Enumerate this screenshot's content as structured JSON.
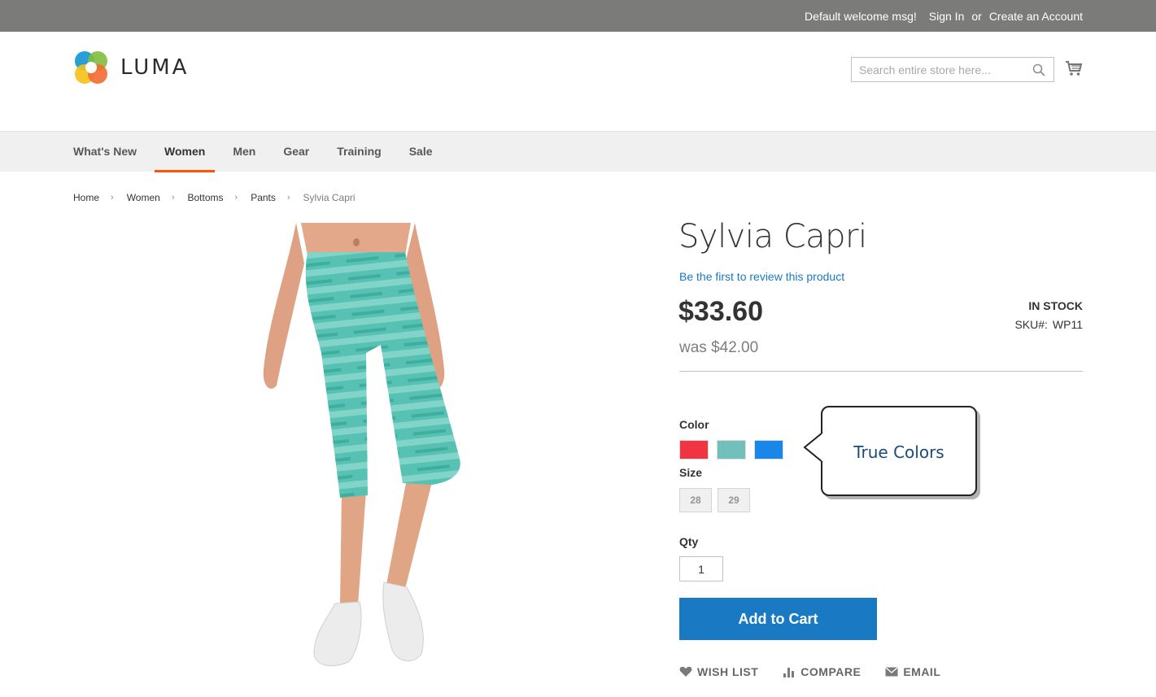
{
  "header": {
    "welcome": "Default welcome msg!",
    "sign_in": "Sign In",
    "or": "or",
    "create_account": "Create an Account",
    "logo_text": "LUMA",
    "search_placeholder": "Search entire store here..."
  },
  "nav": {
    "items": [
      {
        "label": "What's New"
      },
      {
        "label": "Women",
        "active": true
      },
      {
        "label": "Men"
      },
      {
        "label": "Gear"
      },
      {
        "label": "Training"
      },
      {
        "label": "Sale"
      }
    ]
  },
  "breadcrumb": [
    "Home",
    "Women",
    "Bottoms",
    "Pants",
    "Sylvia Capri"
  ],
  "product": {
    "name": "Sylvia Capri",
    "review_link": "Be the first to review this product",
    "price": "$33.60",
    "old_price": "was $42.00",
    "stock": "In stock",
    "sku_label": "SKU#:",
    "sku": "WP11",
    "color_label": "Color",
    "colors": [
      "#ef3542",
      "#72bfbc",
      "#1a87e8"
    ],
    "size_label": "Size",
    "sizes": [
      "28",
      "29"
    ],
    "qty_label": "Qty",
    "qty": "1",
    "add_to_cart": "Add to Cart",
    "actions": [
      "Wish List",
      "Compare",
      "Email"
    ]
  },
  "callout": {
    "text": "True Colors"
  },
  "colors": {
    "accent": "#1979c3",
    "nav_active": "#ff5501",
    "topbar": "#7b7c79"
  }
}
